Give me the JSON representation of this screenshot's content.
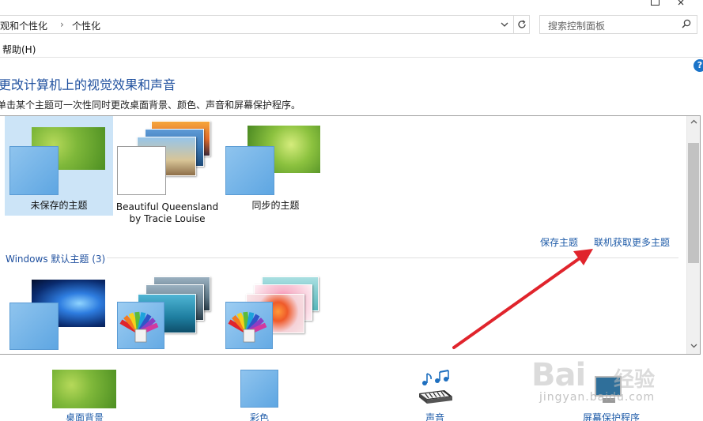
{
  "addressbar": {
    "crumbs": [
      "外观和个性化",
      "个性化"
    ],
    "separator": "›",
    "search_placeholder": "搜索控制面板"
  },
  "menu": {
    "help": "帮助(H)"
  },
  "page": {
    "title": "更改计算机上的视觉效果和声音",
    "description": "单击某个主题可一次性同时更改桌面背景、颜色、声音和屏幕保护程序。"
  },
  "my_themes": [
    {
      "label": "未保存的主题",
      "selected": true
    },
    {
      "label": "Beautiful Queensland",
      "label2": "by Tracie Louise",
      "selected": false
    },
    {
      "label": "同步的主题",
      "selected": false
    }
  ],
  "links": {
    "save_theme": "保存主题",
    "get_more": "联机获取更多主题"
  },
  "windows_section": {
    "heading": "Windows 默认主题 (3)"
  },
  "bottom": {
    "desktop_background": "桌面背景",
    "color": "彩色",
    "sounds": "声音",
    "screensaver": "屏幕保护程序"
  },
  "watermark": {
    "brand": "Bai",
    "brand_cn": "经验",
    "site": "jingyan.baidu.com"
  },
  "colors": {
    "accent": "#1e4f9e",
    "link": "#1e5ba8",
    "selection": "#cce4f7",
    "arrow": "#e0242c"
  }
}
